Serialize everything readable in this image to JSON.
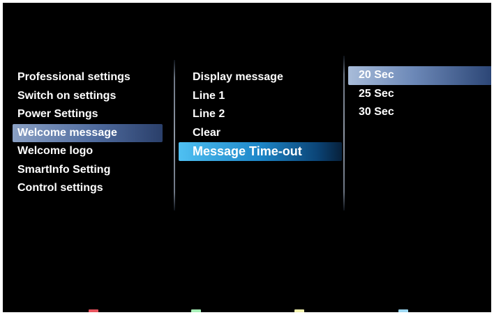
{
  "menu": {
    "column1": {
      "items": [
        {
          "label": "Professional settings"
        },
        {
          "label": "Switch on settings"
        },
        {
          "label": "Power Settings"
        },
        {
          "label": "Welcome message",
          "selected": true
        },
        {
          "label": "Welcome logo"
        },
        {
          "label": "SmartInfo Setting"
        },
        {
          "label": "Control settings"
        }
      ]
    },
    "column2": {
      "items": [
        {
          "label": "Display message"
        },
        {
          "label": "Line 1"
        },
        {
          "label": "Line 2"
        },
        {
          "label": "Clear"
        },
        {
          "label": "Message Time-out",
          "selected": true
        }
      ]
    },
    "column3": {
      "items": [
        {
          "label": "20 Sec",
          "selected": true
        },
        {
          "label": "25 Sec"
        },
        {
          "label": "30 Sec"
        }
      ]
    }
  },
  "color_keys": [
    {
      "name": "red",
      "color": "#e8545e"
    },
    {
      "name": "green",
      "color": "#a8f0b8"
    },
    {
      "name": "yellow",
      "color": "#f2f2b0"
    },
    {
      "name": "blue",
      "color": "#9ed8f2"
    }
  ],
  "colors": {
    "background": "#000000",
    "text": "#ffffff",
    "selected_column1": "#6a82ad",
    "selected_column2": "#1d86c8",
    "selected_column3": "#8ea6cc"
  }
}
